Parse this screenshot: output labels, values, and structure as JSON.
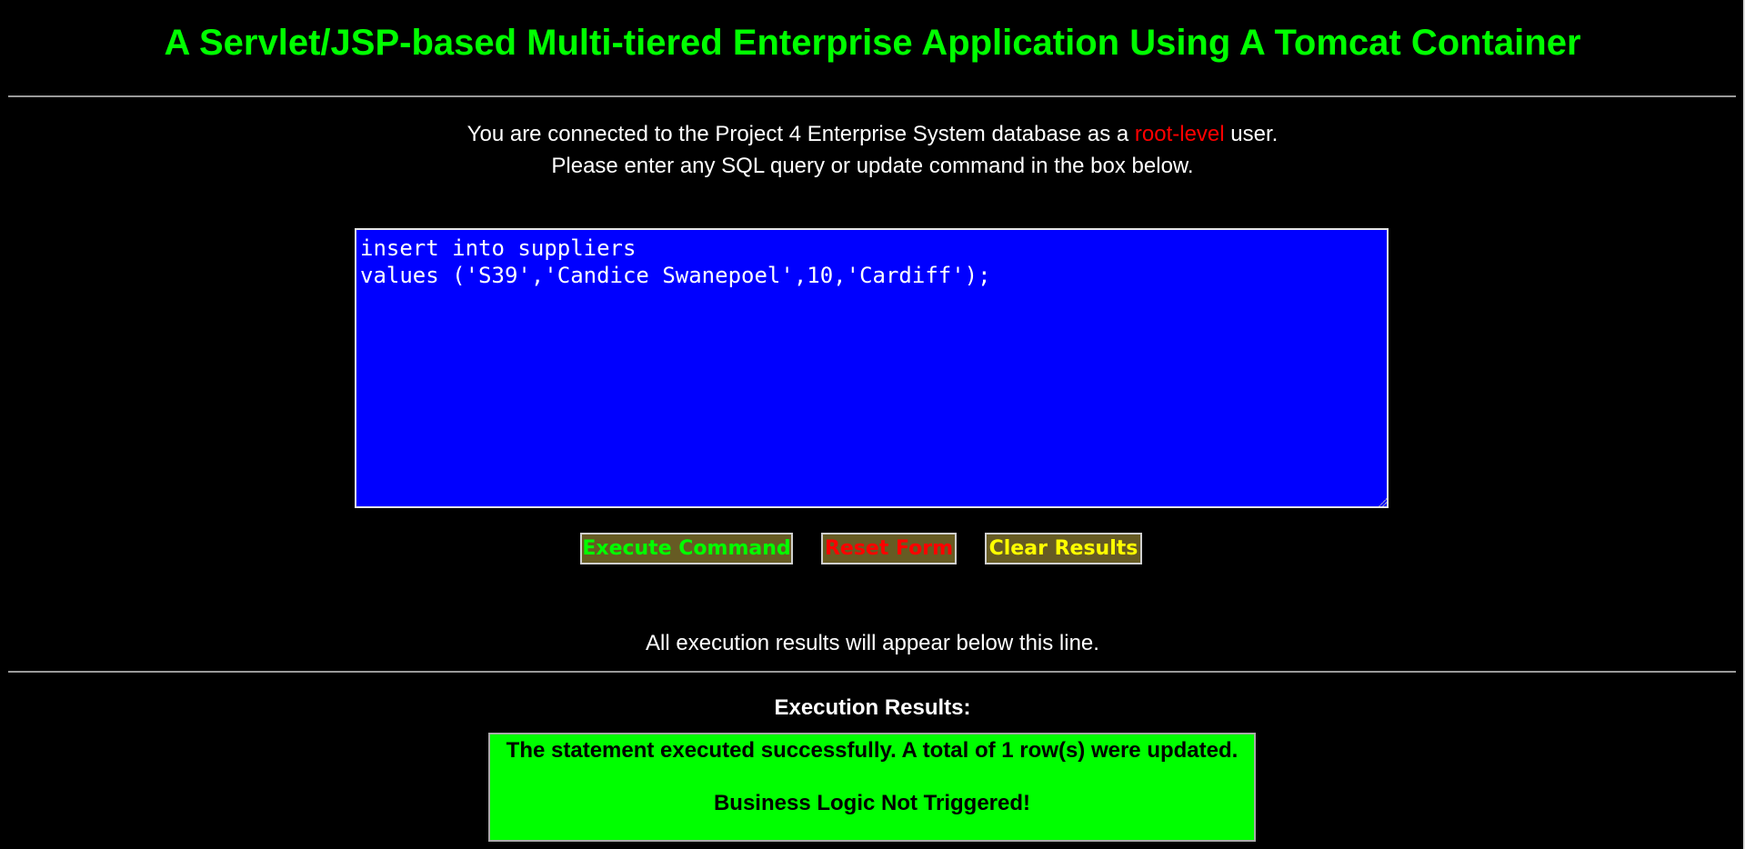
{
  "header": {
    "title": "A Servlet/JSP-based Multi-tiered Enterprise Application Using A Tomcat Container"
  },
  "intro": {
    "line1_before": "You are connected to the Project 4 Enterprise System database as a ",
    "role": "root-level",
    "line1_after": " user.",
    "line2": "Please enter any SQL query or update command in the box below."
  },
  "query": {
    "value": "insert into suppliers\nvalues ('S39','Candice Swanepoel',10,'Cardiff');"
  },
  "buttons": {
    "execute_label": "Execute Command",
    "reset_label": "Reset Form",
    "clear_label": "Clear Results"
  },
  "results": {
    "notice": "All execution results will appear below this line.",
    "heading": "Execution Results:",
    "message": "The statement executed successfully. A total of 1 row(s) were updated.",
    "business_logic": "Business Logic Not Triggered!"
  },
  "colors": {
    "background": "#000000",
    "title": "#00ff00",
    "role_highlight": "#ff0000",
    "query_box": "#0000ff",
    "button_bg": "#665b23",
    "execute_text": "#00ff00",
    "reset_text": "#ff0000",
    "clear_text": "#ffff00",
    "result_bg": "#00ff00"
  }
}
